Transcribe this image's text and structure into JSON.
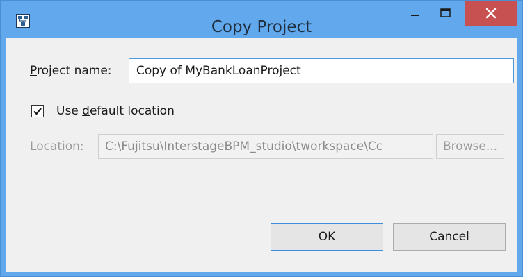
{
  "window": {
    "title": "Copy Project",
    "app_icon": "interstage-studio-icon",
    "controls": [
      "minimize-icon",
      "maximize-icon",
      "close-icon"
    ]
  },
  "form": {
    "project_name_label_prefix": "P",
    "project_name_label_rest": "roject name:",
    "project_name_value": "Copy of MyBankLoanProject",
    "use_default_label_pre": "Use ",
    "use_default_label_accel": "d",
    "use_default_label_rest": "efault location",
    "use_default_checked": true,
    "location_label_accel": "L",
    "location_label_rest": "ocation:",
    "location_value": "C:\\Fujitsu\\InterstageBPM_studio\\tworkspace\\Cc",
    "browse_label_pre": "Br",
    "browse_label_accel": "o",
    "browse_label_rest": "wse..."
  },
  "buttons": {
    "ok": "OK",
    "cancel": "Cancel"
  },
  "colors": {
    "titlebar": "#62a8ec",
    "close_button": "#c75050",
    "dialog_background": "#f0f0f0",
    "focus_border": "#4f9ad8"
  }
}
